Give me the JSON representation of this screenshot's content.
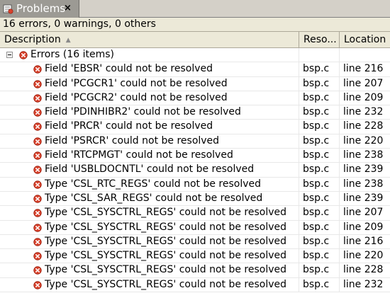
{
  "tab": {
    "title": "Problems",
    "close_glyph": "×",
    "icon": "problems-view-icon"
  },
  "summary": "16 errors, 0 warnings, 0 others",
  "columns": {
    "description": "Description",
    "resource": "Reso...",
    "location": "Location"
  },
  "group": {
    "label": "Errors (16 items)",
    "icon": "error-icon"
  },
  "colors": {
    "error": "#d9412b",
    "tab_bg": "#9c9a94",
    "header_bg": "#ece9d8"
  },
  "errors": [
    {
      "description": "Field 'EBSR' could not be resolved",
      "resource": "bsp.c",
      "location": "line 216"
    },
    {
      "description": "Field 'PCGCR1' could not be resolved",
      "resource": "bsp.c",
      "location": "line 207"
    },
    {
      "description": "Field 'PCGCR2' could not be resolved",
      "resource": "bsp.c",
      "location": "line 209"
    },
    {
      "description": "Field 'PDINHIBR2' could not be resolved",
      "resource": "bsp.c",
      "location": "line 232"
    },
    {
      "description": "Field 'PRCR' could not be resolved",
      "resource": "bsp.c",
      "location": "line 228"
    },
    {
      "description": "Field 'PSRCR' could not be resolved",
      "resource": "bsp.c",
      "location": "line 220"
    },
    {
      "description": "Field 'RTCPMGT' could not be resolved",
      "resource": "bsp.c",
      "location": "line 238"
    },
    {
      "description": "Field 'USBLDOCNTL' could not be resolved",
      "resource": "bsp.c",
      "location": "line 239"
    },
    {
      "description": "Type 'CSL_RTC_REGS' could not be resolved",
      "resource": "bsp.c",
      "location": "line 238"
    },
    {
      "description": "Type 'CSL_SAR_REGS' could not be resolved",
      "resource": "bsp.c",
      "location": "line 239"
    },
    {
      "description": "Type 'CSL_SYSCTRL_REGS' could not be resolved",
      "resource": "bsp.c",
      "location": "line 207"
    },
    {
      "description": "Type 'CSL_SYSCTRL_REGS' could not be resolved",
      "resource": "bsp.c",
      "location": "line 209"
    },
    {
      "description": "Type 'CSL_SYSCTRL_REGS' could not be resolved",
      "resource": "bsp.c",
      "location": "line 216"
    },
    {
      "description": "Type 'CSL_SYSCTRL_REGS' could not be resolved",
      "resource": "bsp.c",
      "location": "line 220"
    },
    {
      "description": "Type 'CSL_SYSCTRL_REGS' could not be resolved",
      "resource": "bsp.c",
      "location": "line 228"
    },
    {
      "description": "Type 'CSL_SYSCTRL_REGS' could not be resolved",
      "resource": "bsp.c",
      "location": "line 232"
    }
  ]
}
